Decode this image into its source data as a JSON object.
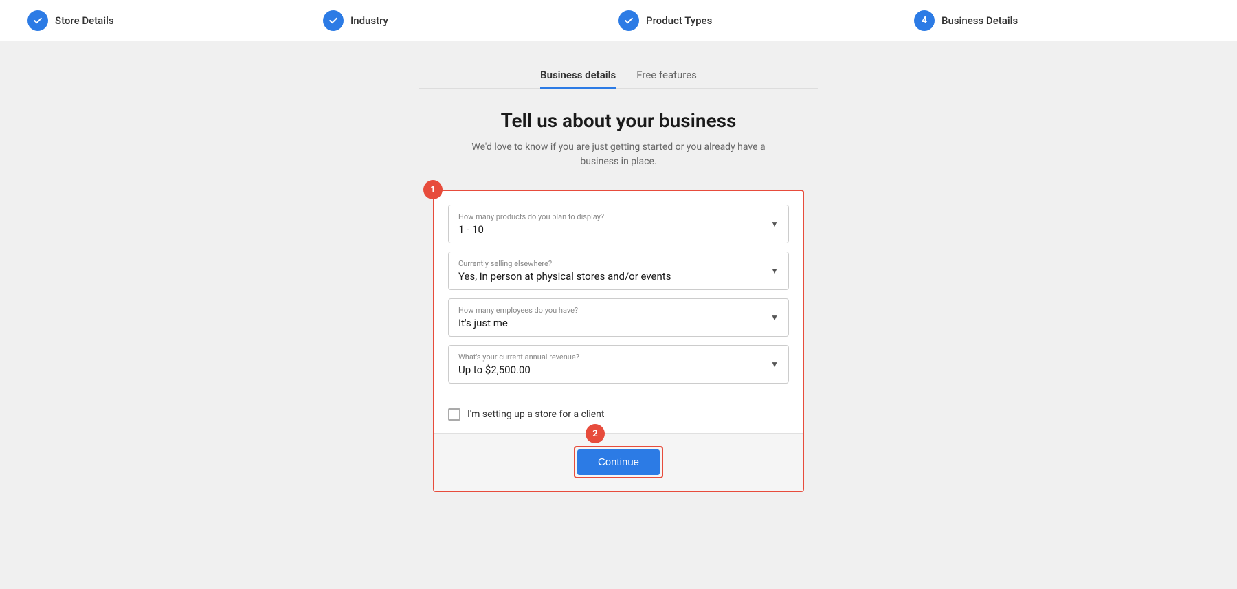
{
  "progressBar": {
    "steps": [
      {
        "id": "store-details",
        "label": "Store Details",
        "status": "completed",
        "icon": "check"
      },
      {
        "id": "industry",
        "label": "Industry",
        "status": "completed",
        "icon": "check"
      },
      {
        "id": "product-types",
        "label": "Product Types",
        "status": "completed",
        "icon": "check"
      },
      {
        "id": "business-details",
        "label": "Business Details",
        "status": "active",
        "icon": "4"
      }
    ]
  },
  "tabs": [
    {
      "id": "business-details",
      "label": "Business details",
      "active": true
    },
    {
      "id": "free-features",
      "label": "Free features",
      "active": false
    }
  ],
  "heading": "Tell us about your business",
  "subtext": "We'd love to know if you are just getting started or you already have a business in place.",
  "annotations": {
    "badge1": "1",
    "badge2": "2"
  },
  "form": {
    "fields": [
      {
        "id": "products-count",
        "label": "How many products do you plan to display?",
        "value": "1 - 10"
      },
      {
        "id": "selling-elsewhere",
        "label": "Currently selling elsewhere?",
        "value": "Yes, in person at physical stores and/or events"
      },
      {
        "id": "employees",
        "label": "How many employees do you have?",
        "value": "It's just me"
      },
      {
        "id": "annual-revenue",
        "label": "What's your current annual revenue?",
        "value": "Up to $2,500.00"
      }
    ],
    "checkbox": {
      "id": "client-store",
      "label": "I'm setting up a store for a client",
      "checked": false
    }
  },
  "continueButton": {
    "label": "Continue"
  }
}
